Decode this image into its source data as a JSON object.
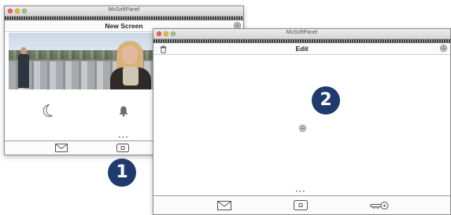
{
  "window1": {
    "app_title": "MxSoftPanel",
    "toolbar_title": "New Screen",
    "add_symbol": "⊕",
    "page_dots": "•••",
    "tabbar": [
      "mail-icon",
      "button-icon"
    ]
  },
  "window2": {
    "app_title": "MxSoftPanel",
    "toolbar_title": "Edit",
    "add_symbol": "⊕",
    "canvas_add_symbol": "⊕",
    "page_dots": "•••",
    "tabbar": [
      "mail-icon",
      "button-icon",
      "key-icon"
    ]
  },
  "callouts": {
    "one": "1",
    "two": "2"
  },
  "colors": {
    "badge": "#1f3b6e",
    "close": "#ff5f57",
    "minimize": "#febc2e",
    "zoom": "#9fd08a"
  }
}
